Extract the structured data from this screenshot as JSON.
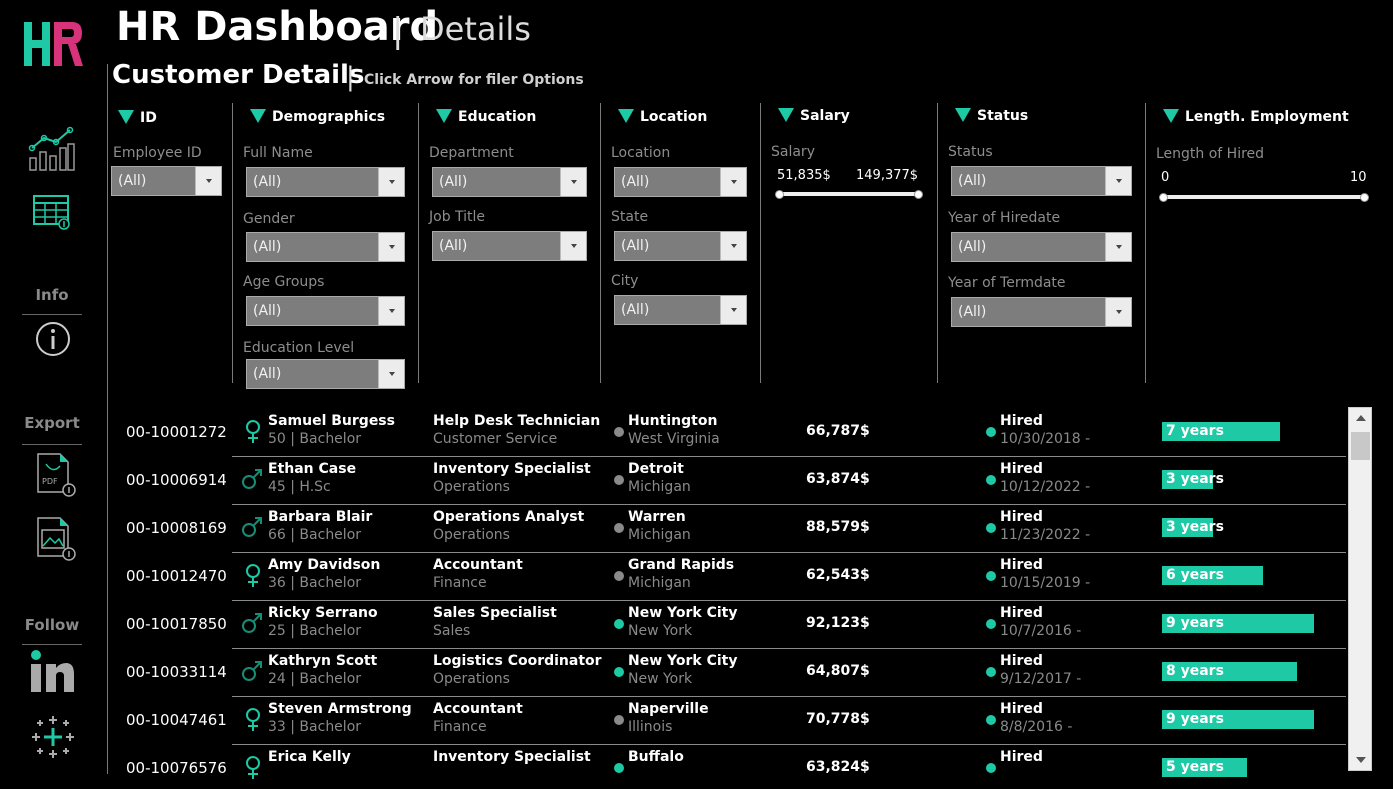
{
  "header": {
    "title": "HR Dashboard",
    "divider": "|",
    "subtitle": "Details",
    "section_title": "Customer Details",
    "section_hint": "Click Arrow for filer Options"
  },
  "sidebar": {
    "logo_text": "HR",
    "info_label": "Info",
    "export_label": "Export",
    "follow_label": "Follow"
  },
  "filters": {
    "id": {
      "title": "ID",
      "employee_id_label": "Employee ID",
      "employee_id_value": "(All)"
    },
    "demographics": {
      "title": "Demographics",
      "full_name_label": "Full Name",
      "full_name_value": "(All)",
      "gender_label": "Gender",
      "gender_value": "(All)",
      "age_groups_label": "Age Groups",
      "age_groups_value": "(All)",
      "education_level_label": "Education Level",
      "education_level_value": "(All)"
    },
    "education": {
      "title": "Education",
      "department_label": "Department",
      "department_value": "(All)",
      "job_title_label": "Job Title",
      "job_title_value": "(All)"
    },
    "location": {
      "title": "Location",
      "location_label": "Location",
      "location_value": "(All)",
      "state_label": "State",
      "state_value": "(All)",
      "city_label": "City",
      "city_value": "(All)"
    },
    "salary": {
      "title": "Salary",
      "label": "Salary",
      "min": "51,835$",
      "max": "149,377$"
    },
    "status": {
      "title": "Status",
      "status_label": "Status",
      "status_value": "(All)",
      "year_hire_label": "Year of Hiredate",
      "year_hire_value": "(All)",
      "year_term_label": "Year of Termdate",
      "year_term_value": "(All)"
    },
    "length": {
      "title": "Length. Employment",
      "label": "Length of Hired",
      "min": "0",
      "max": "10"
    }
  },
  "colors": {
    "accent": "#1ec9a5",
    "grey_dot": "#8a8a8a",
    "accent_dot": "#1ec9a5"
  },
  "table": {
    "max_years": 10,
    "rows": [
      {
        "id": "00-10001272",
        "gender": "female",
        "name": "Samuel Burgess",
        "info": "50 | Bachelor",
        "job": "Help Desk Technician",
        "dept": "Customer Service",
        "city": "Huntington",
        "state": "West Virginia",
        "loc_dot": "grey",
        "salary": "66,787$",
        "status": "Hired",
        "date": "10/30/2018 -",
        "years": 7,
        "years_label": "7 years"
      },
      {
        "id": "00-10006914",
        "gender": "male",
        "name": "Ethan Case",
        "info": "45 | H.Sc",
        "job": "Inventory Specialist",
        "dept": "Operations",
        "city": "Detroit",
        "state": "Michigan",
        "loc_dot": "grey",
        "salary": "63,874$",
        "status": "Hired",
        "date": "10/12/2022 -",
        "years": 3,
        "years_label": "3 years"
      },
      {
        "id": "00-10008169",
        "gender": "male",
        "name": "Barbara Blair",
        "info": "66 | Bachelor",
        "job": "Operations Analyst",
        "dept": "Operations",
        "city": "Warren",
        "state": "Michigan",
        "loc_dot": "grey",
        "salary": "88,579$",
        "status": "Hired",
        "date": "11/23/2022 -",
        "years": 3,
        "years_label": "3 years"
      },
      {
        "id": "00-10012470",
        "gender": "female",
        "name": "Amy Davidson",
        "info": "36 | Bachelor",
        "job": "Accountant",
        "dept": "Finance",
        "city": "Grand Rapids",
        "state": "Michigan",
        "loc_dot": "grey",
        "salary": "62,543$",
        "status": "Hired",
        "date": "10/15/2019 -",
        "years": 6,
        "years_label": "6 years"
      },
      {
        "id": "00-10017850",
        "gender": "male",
        "name": "Ricky Serrano",
        "info": "25 | Bachelor",
        "job": "Sales Specialist",
        "dept": "Sales",
        "city": "New York City",
        "state": "New York",
        "loc_dot": "accent",
        "salary": "92,123$",
        "status": "Hired",
        "date": "10/7/2016 -",
        "years": 9,
        "years_label": "9 years"
      },
      {
        "id": "00-10033114",
        "gender": "male",
        "name": "Kathryn Scott",
        "info": "24 | Bachelor",
        "job": "Logistics Coordinator",
        "dept": "Operations",
        "city": "New York City",
        "state": "New York",
        "loc_dot": "accent",
        "salary": "64,807$",
        "status": "Hired",
        "date": "9/12/2017 -",
        "years": 8,
        "years_label": "8 years"
      },
      {
        "id": "00-10047461",
        "gender": "female",
        "name": "Steven Armstrong",
        "info": "33 | Bachelor",
        "job": "Accountant",
        "dept": "Finance",
        "city": "Naperville",
        "state": "Illinois",
        "loc_dot": "grey",
        "salary": "70,778$",
        "status": "Hired",
        "date": "8/8/2016 -",
        "years": 9,
        "years_label": "9 years"
      },
      {
        "id": "00-10076576",
        "gender": "female",
        "name": "Erica Kelly",
        "info": "",
        "job": "Inventory Specialist",
        "dept": "",
        "city": "Buffalo",
        "state": "",
        "loc_dot": "accent",
        "salary": "63,824$",
        "status": "Hired",
        "date": "",
        "years": 5,
        "years_label": "5 years"
      }
    ]
  }
}
